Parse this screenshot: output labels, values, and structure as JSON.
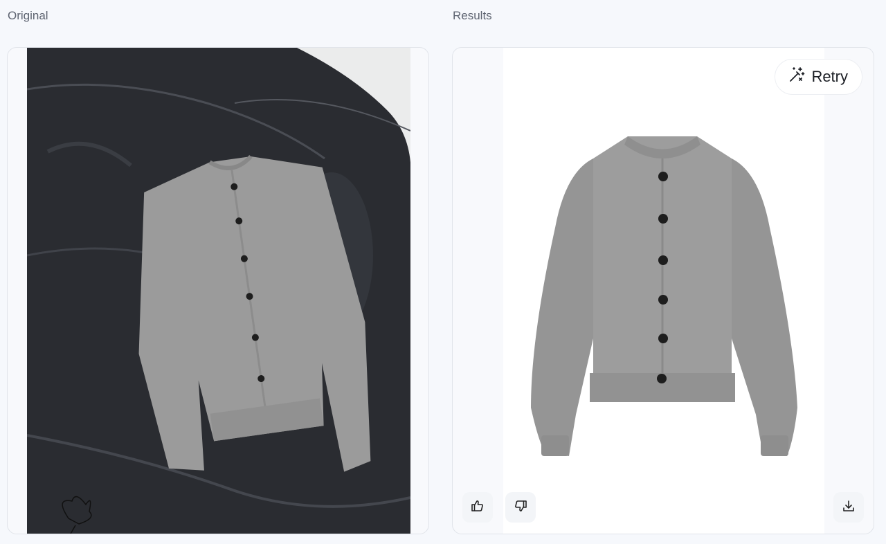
{
  "labels": {
    "original": "Original",
    "results": "Results"
  },
  "actions": {
    "retry_label": "Retry",
    "retry_icon": "magic-wand-icon",
    "like_icon": "thumbs-up-icon",
    "dislike_icon": "thumbs-down-icon",
    "download_icon": "download-icon"
  },
  "images": {
    "original": "photo of grey button-up cardigan laid on black leather pouf",
    "result": "grey cardigan on white background"
  },
  "colors": {
    "background": "#f6f8fc",
    "panel_border": "#e1e4ea",
    "garment": "#9a9a9a",
    "buttons_on_garment": "#1e1e1e"
  }
}
